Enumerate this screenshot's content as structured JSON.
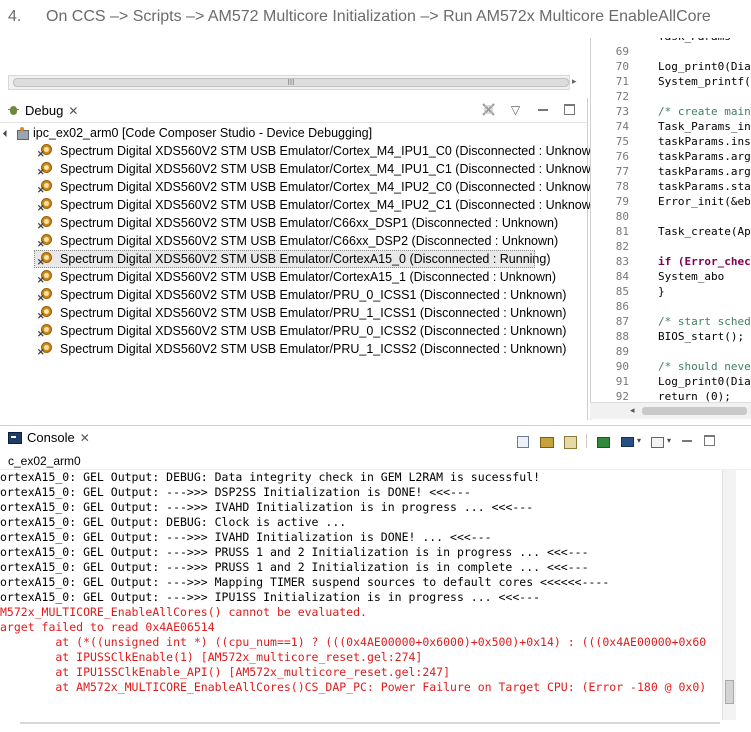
{
  "step": {
    "number": "4.",
    "text": "On CCS –> Scripts –> AM572 Multicore Initialization –> Run AM572x Multicore EnableAllCore"
  },
  "top_scrollbar": {
    "thumb_grip": "III",
    "right_arrow": "▸"
  },
  "debug_view": {
    "tab_label": "Debug",
    "tab_close": "✕",
    "toolbar": {
      "menu": "▽"
    },
    "root": "ipc_ex02_arm0 [Code Composer Studio - Device Debugging]",
    "items": [
      {
        "label": "Spectrum Digital XDS560V2 STM USB Emulator/Cortex_M4_IPU1_C0 (Disconnected : Unknown)",
        "selected": false
      },
      {
        "label": "Spectrum Digital XDS560V2 STM USB Emulator/Cortex_M4_IPU1_C1 (Disconnected : Unknown)",
        "selected": false
      },
      {
        "label": "Spectrum Digital XDS560V2 STM USB Emulator/Cortex_M4_IPU2_C0 (Disconnected : Unknown)",
        "selected": false
      },
      {
        "label": "Spectrum Digital XDS560V2 STM USB Emulator/Cortex_M4_IPU2_C1 (Disconnected : Unknown)",
        "selected": false
      },
      {
        "label": "Spectrum Digital XDS560V2 STM USB Emulator/C66xx_DSP1 (Disconnected : Unknown)",
        "selected": false
      },
      {
        "label": "Spectrum Digital XDS560V2 STM USB Emulator/C66xx_DSP2 (Disconnected : Unknown)",
        "selected": false
      },
      {
        "label": "Spectrum Digital XDS560V2 STM USB Emulator/CortexA15_0 (Disconnected : Running)",
        "selected": true
      },
      {
        "label": "Spectrum Digital XDS560V2 STM USB Emulator/CortexA15_1 (Disconnected : Unknown)",
        "selected": false
      },
      {
        "label": "Spectrum Digital XDS560V2 STM USB Emulator/PRU_0_ICSS1 (Disconnected : Unknown)",
        "selected": false
      },
      {
        "label": "Spectrum Digital XDS560V2 STM USB Emulator/PRU_1_ICSS1 (Disconnected : Unknown)",
        "selected": false
      },
      {
        "label": "Spectrum Digital XDS560V2 STM USB Emulator/PRU_0_ICSS2 (Disconnected : Unknown)",
        "selected": false
      },
      {
        "label": "Spectrum Digital XDS560V2 STM USB Emulator/PRU_1_ICSS2 (Disconnected : Unknown)",
        "selected": false
      }
    ]
  },
  "editor": {
    "lines": [
      {
        "num": "",
        "text": "Task_Params",
        "kind": "normal"
      },
      {
        "num": "69",
        "text": "",
        "kind": "normal"
      },
      {
        "num": "70",
        "text": "Log_print0(Dia",
        "kind": "normal"
      },
      {
        "num": "71",
        "text": "System_printf(",
        "kind": "normal"
      },
      {
        "num": "72",
        "text": "",
        "kind": "normal"
      },
      {
        "num": "73",
        "text": "/* create main",
        "kind": "comment"
      },
      {
        "num": "74",
        "text": "Task_Params_in",
        "kind": "normal"
      },
      {
        "num": "75",
        "text": "taskParams.ins",
        "kind": "normal"
      },
      {
        "num": "76",
        "text": "taskParams.arg",
        "kind": "normal"
      },
      {
        "num": "77",
        "text": "taskParams.arg",
        "kind": "normal"
      },
      {
        "num": "78",
        "text": "taskParams.sta",
        "kind": "normal"
      },
      {
        "num": "79",
        "text": "Error_init(&eb",
        "kind": "normal"
      },
      {
        "num": "80",
        "text": "",
        "kind": "normal"
      },
      {
        "num": "81",
        "text": "Task_create(Ap",
        "kind": "normal"
      },
      {
        "num": "82",
        "text": "",
        "kind": "normal"
      },
      {
        "num": "83",
        "text": "if (Error_chec",
        "kind": "keyword"
      },
      {
        "num": "84",
        "text": "  System_abo",
        "kind": "normal"
      },
      {
        "num": "85",
        "text": "}",
        "kind": "normal"
      },
      {
        "num": "86",
        "text": "",
        "kind": "normal"
      },
      {
        "num": "87",
        "text": "/* start sched",
        "kind": "comment"
      },
      {
        "num": "88",
        "text": "BIOS_start();",
        "kind": "normal"
      },
      {
        "num": "89",
        "text": "",
        "kind": "normal"
      },
      {
        "num": "90",
        "text": "/* should neve",
        "kind": "comment"
      },
      {
        "num": "91",
        "text": "Log_print0(Dia",
        "kind": "normal"
      },
      {
        "num": "92",
        "text": "return (0);",
        "kind": "normal"
      }
    ],
    "scroll_left": "◂"
  },
  "console": {
    "tab_label": "Console",
    "tab_close": "✕",
    "process_label": "c_ex02_arm0",
    "toolbar": {
      "dropdown": "▾"
    },
    "lines": [
      {
        "text": "ortexA15_0: GEL Output: DEBUG: Data integrity check in GEM L2RAM is sucessful!",
        "error": false
      },
      {
        "text": "ortexA15_0: GEL Output: --->>> DSP2SS Initialization is DONE! <<<---",
        "error": false
      },
      {
        "text": "ortexA15_0: GEL Output: --->>> IVAHD Initialization is in progress ... <<<---",
        "error": false
      },
      {
        "text": "ortexA15_0: GEL Output: DEBUG: Clock is active ...",
        "error": false
      },
      {
        "text": "ortexA15_0: GEL Output: --->>> IVAHD Initialization is DONE! ... <<<---",
        "error": false
      },
      {
        "text": "ortexA15_0: GEL Output: --->>> PRUSS 1 and 2 Initialization is in progress ... <<<---",
        "error": false
      },
      {
        "text": "ortexA15_0: GEL Output: --->>> PRUSS 1 and 2 Initialization is in complete ... <<<---",
        "error": false
      },
      {
        "text": "ortexA15_0: GEL Output: --->>> Mapping TIMER suspend sources to default cores <<<<<<----",
        "error": false
      },
      {
        "text": "ortexA15_0: GEL Output: --->>> IPU1SS Initialization is in progress ... <<<---",
        "error": false
      },
      {
        "text": "M572x_MULTICORE_EnableAllCores() cannot be evaluated.",
        "error": true
      },
      {
        "text": "arget failed to read 0x4AE06514",
        "error": true
      },
      {
        "text": "        at (*((unsigned int *) ((cpu_num==1) ? (((0x4AE00000+0x6000)+0x500)+0x14) : (((0x4AE00000+0x60",
        "error": true
      },
      {
        "text": "        at IPUSSClkEnable(1) [AM572x_multicore_reset.gel:274]",
        "error": true
      },
      {
        "text": "        at IPU1SSClkEnable_API() [AM572x_multicore_reset.gel:247]",
        "error": true
      },
      {
        "text": "        at AM572x_MULTICORE_EnableAllCores()CS_DAP_PC: Power Failure on Target CPU: (Error -180 @ 0x0)",
        "error": true
      }
    ]
  }
}
